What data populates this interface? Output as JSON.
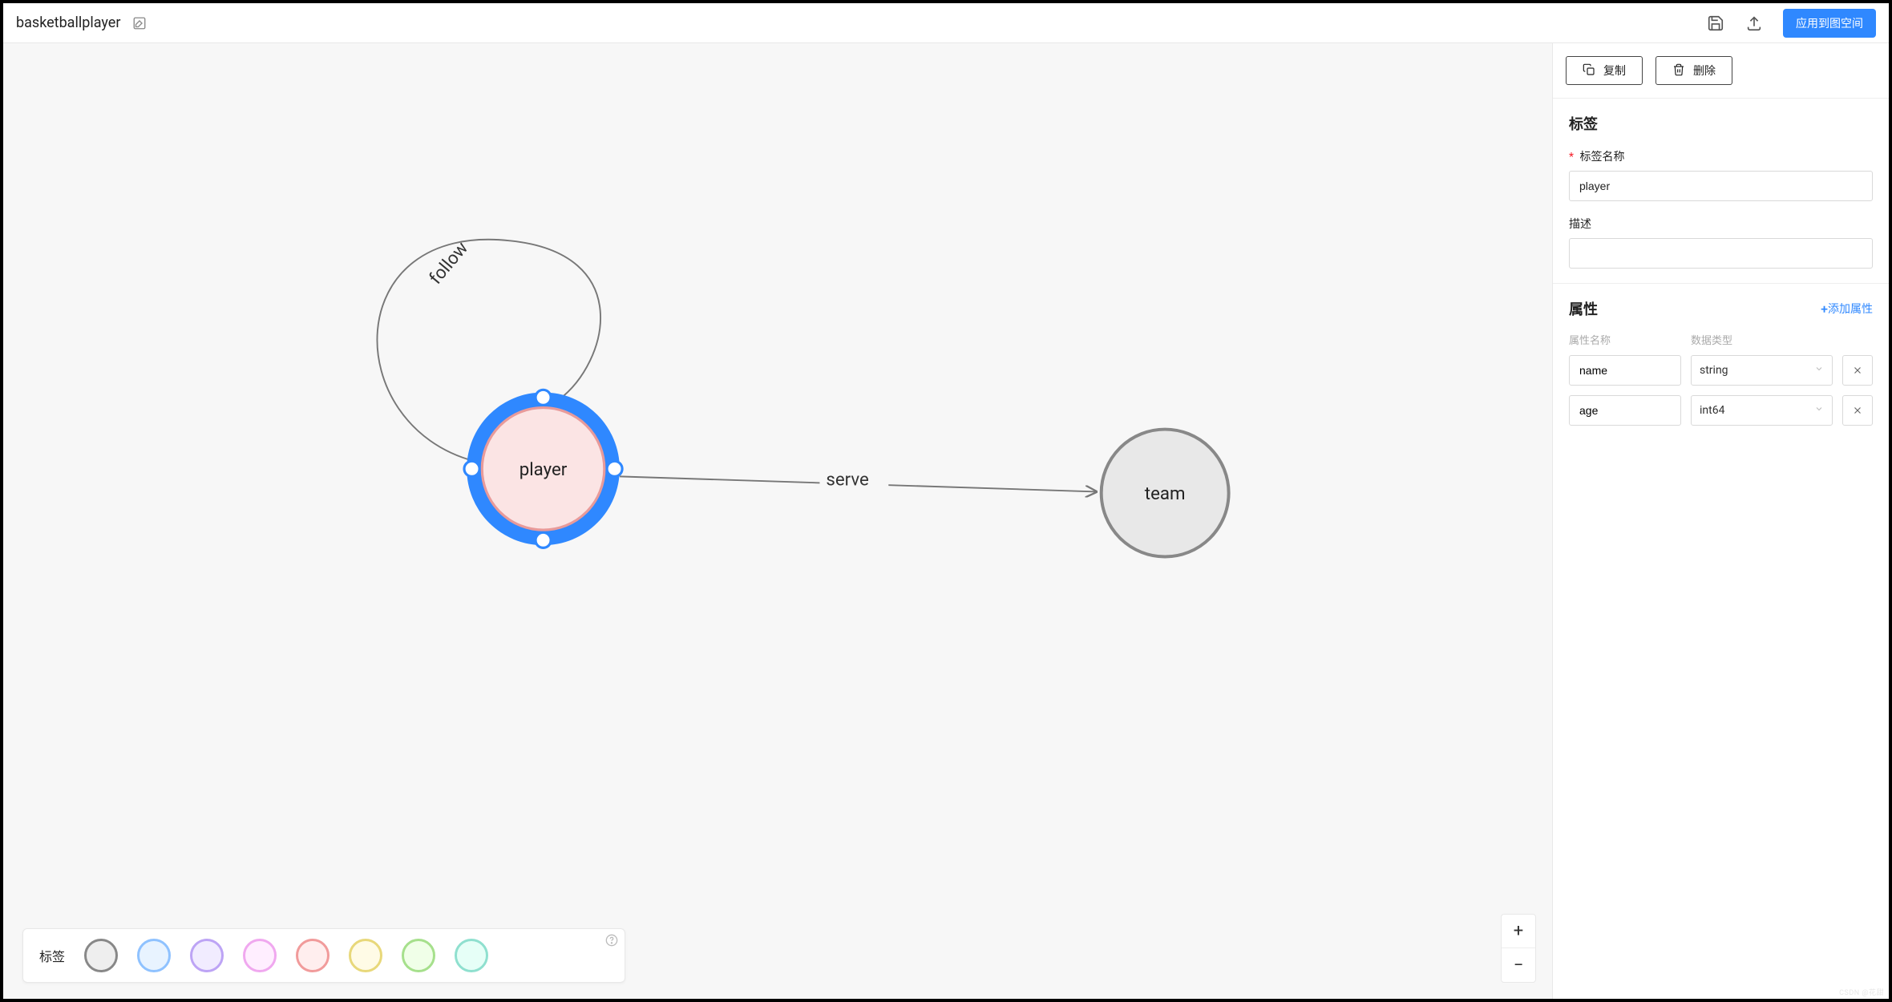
{
  "header": {
    "title": "basketballplayer",
    "apply_label": "应用到图空间"
  },
  "canvas": {
    "nodes": {
      "player": {
        "label": "player"
      },
      "team": {
        "label": "team"
      }
    },
    "edges": {
      "follow": {
        "label": "follow"
      },
      "serve": {
        "label": "serve"
      }
    }
  },
  "palette": {
    "label": "标签",
    "swatches": [
      {
        "fill": "#eeeeee",
        "stroke": "#888888"
      },
      {
        "fill": "#e8f3ff",
        "stroke": "#8fc2ff"
      },
      {
        "fill": "#f1ecff",
        "stroke": "#bda4f5"
      },
      {
        "fill": "#ffeeff",
        "stroke": "#f0a8ef"
      },
      {
        "fill": "#ffeeee",
        "stroke": "#f19b9b"
      },
      {
        "fill": "#fffbe6",
        "stroke": "#e8d87a"
      },
      {
        "fill": "#f0ffe8",
        "stroke": "#a6e08c"
      },
      {
        "fill": "#e6fff7",
        "stroke": "#8fe0cf"
      }
    ]
  },
  "panel": {
    "actions": {
      "copy_label": "复制",
      "delete_label": "删除"
    },
    "tag_section": {
      "title": "标签",
      "name_label": "标签名称",
      "name_value": "player",
      "desc_label": "描述",
      "desc_value": ""
    },
    "props_section": {
      "title": "属性",
      "add_label": "添加属性",
      "col_name_label": "属性名称",
      "col_type_label": "数据类型",
      "rows": [
        {
          "name": "name",
          "type": "string"
        },
        {
          "name": "age",
          "type": "int64"
        }
      ]
    }
  },
  "watermark": "CSDN @花甜"
}
